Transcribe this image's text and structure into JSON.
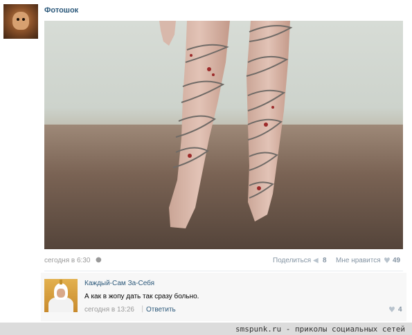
{
  "post": {
    "group_name": "Фотошок",
    "date": "сегодня в 6:30",
    "share_label": "Поделиться",
    "share_count": "8",
    "like_label": "Мне нравится",
    "like_count": "49"
  },
  "icons": {
    "platform": "apple-icon",
    "share": "megaphone-icon",
    "like": "heart-icon"
  },
  "comment": {
    "author": "Каждый-Сам За-Себя",
    "text": "А как в жопу дать так сразу больно.",
    "date": "сегодня в 13:26",
    "separator": "|",
    "reply_label": "Ответить",
    "like_count": "4"
  },
  "watermark": {
    "text": "smspunk.ru - приколы социальных сетей"
  },
  "colors": {
    "link": "#2b587a",
    "muted": "#999999",
    "counter": "#8494a3"
  }
}
